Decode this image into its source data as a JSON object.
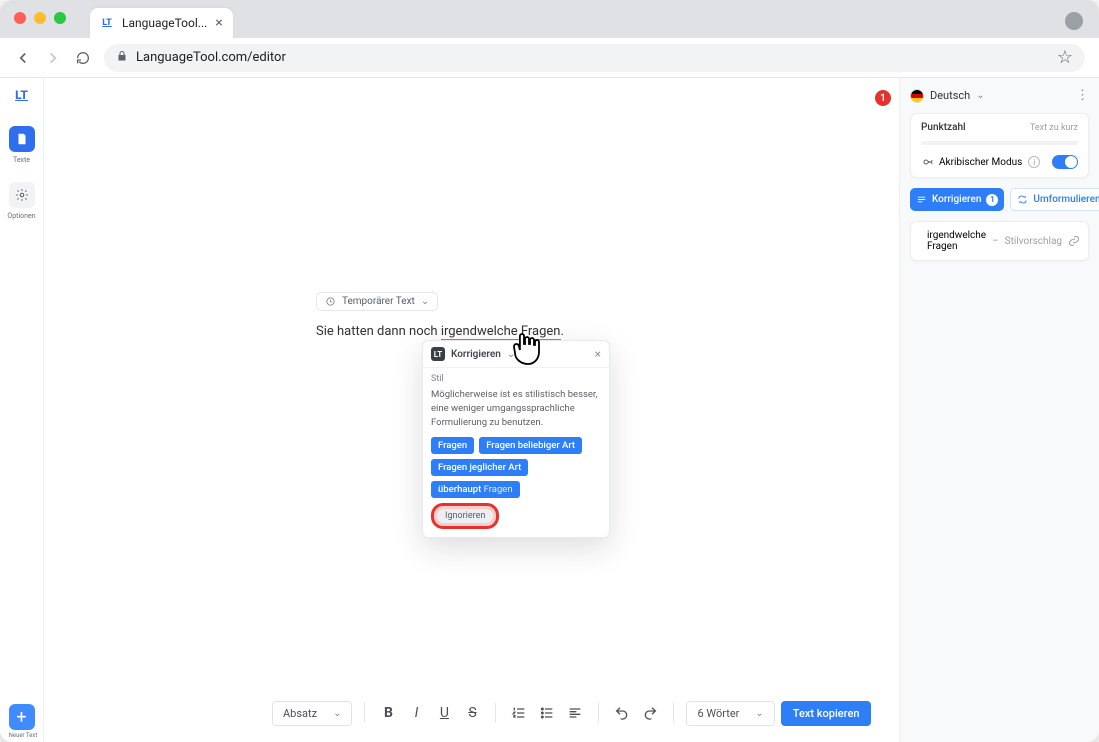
{
  "browser": {
    "tab_title": "LanguageTool...",
    "url": "LanguageTool.com/editor"
  },
  "leftrail": {
    "texte_label": "Texte",
    "optionen_label": "Optionen",
    "new_text_label": "Neuer Text"
  },
  "center": {
    "error_count": "1",
    "doc_chip": "Temporärer Text",
    "line_prefix": "Sie hatten dann noch ",
    "line_phrase": "irgendwelche Fragen",
    "line_suffix": "."
  },
  "popover": {
    "title": "Korrigieren",
    "category": "Stil",
    "message": "Möglicherweise ist es stilistisch besser, eine weniger umgangssprachliche Formulierung zu benutzen.",
    "chips": {
      "s1": "Fragen",
      "s2": "Fragen beliebiger Art",
      "s3": "Fragen jeglicher Art",
      "s4_pre": "überhaupt",
      "s4_light": " Fragen"
    },
    "ignore": "Ignorieren"
  },
  "bottom": {
    "para": "Absatz",
    "wordcount": "6 Wörter",
    "copy": "Text kopieren"
  },
  "right": {
    "language": "Deutsch",
    "score_label": "Punktzahl",
    "score_hint": "Text zu kurz",
    "mode_label": "Akribischer Modus",
    "korrigieren": "Korrigieren",
    "korrigieren_badge": "1",
    "umformulieren": "Umformulieren",
    "suggestion_phrase": "irgendwelche Fragen",
    "suggestion_sep": "–",
    "suggestion_cat": "Stilvorschlag"
  }
}
